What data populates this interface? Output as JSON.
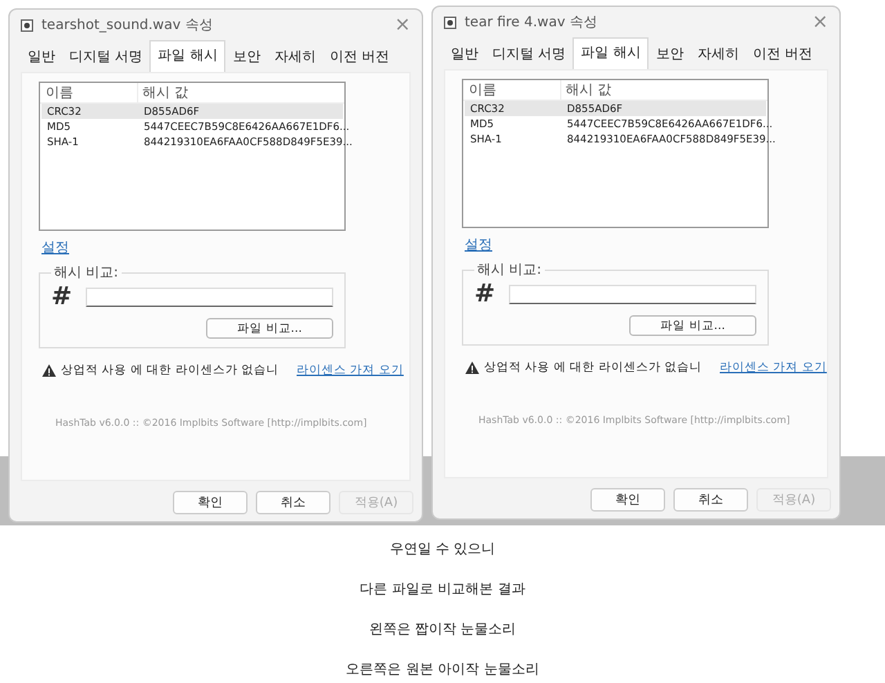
{
  "windows": [
    {
      "title": "tearshot_sound.wav 속성",
      "close": "×",
      "tabs": [
        {
          "label": "일반",
          "selected": false
        },
        {
          "label": "디지털 서명",
          "selected": false
        },
        {
          "label": "파일 해시",
          "selected": true
        },
        {
          "label": "보안",
          "selected": false
        },
        {
          "label": "자세히",
          "selected": false
        },
        {
          "label": "이전 버전",
          "selected": false
        }
      ],
      "hash_list": {
        "columns": [
          "이름",
          "해시 값"
        ],
        "rows": [
          {
            "name": "CRC32",
            "value": "D855AD6F",
            "selected": true
          },
          {
            "name": "MD5",
            "value": "5447CEEC7B59C8E6426AA667E1DF6...",
            "selected": false
          },
          {
            "name": "SHA-1",
            "value": "844219310EA6FAA0CF588D849F5E39...",
            "selected": false
          }
        ]
      },
      "settings_link": "설정",
      "compare_group": {
        "label": "해시 비교:",
        "icon_glyph": "#",
        "button": "파일 비교..."
      },
      "warning": {
        "text": "상업적 사용 에 대한 라이센스가 없습니",
        "link": "라이센스 가져 오기"
      },
      "footer": "HashTab v6.0.0 :: ©2016 Implbits Software [http://implbits.com]",
      "buttons": [
        {
          "label": "확인",
          "disabled": false
        },
        {
          "label": "취소",
          "disabled": false
        },
        {
          "label": "적용(A)",
          "disabled": true
        }
      ]
    },
    {
      "title": "tear fire 4.wav 속성",
      "close": "×",
      "tabs": [
        {
          "label": "일반",
          "selected": false
        },
        {
          "label": "디지털 서명",
          "selected": false
        },
        {
          "label": "파일 해시",
          "selected": true
        },
        {
          "label": "보안",
          "selected": false
        },
        {
          "label": "자세히",
          "selected": false
        },
        {
          "label": "이전 버전",
          "selected": false
        }
      ],
      "hash_list": {
        "columns": [
          "이름",
          "해시 값"
        ],
        "rows": [
          {
            "name": "CRC32",
            "value": "D855AD6F",
            "selected": true
          },
          {
            "name": "MD5",
            "value": "5447CEEC7B59C8E6426AA667E1DF6...",
            "selected": false
          },
          {
            "name": "SHA-1",
            "value": "844219310EA6FAA0CF588D849F5E39...",
            "selected": false
          }
        ]
      },
      "settings_link": "설정",
      "compare_group": {
        "label": "해시 비교:",
        "icon_glyph": "#",
        "button": "파일 비교..."
      },
      "warning": {
        "text": "상업적 사용 에 대한 라이센스가 없습니",
        "link": "라이센스 가져 오기"
      },
      "footer": "HashTab v6.0.0 :: ©2016 Implbits Software [http://implbits.com]",
      "buttons": [
        {
          "label": "확인",
          "disabled": false
        },
        {
          "label": "취소",
          "disabled": false
        },
        {
          "label": "적용(A)",
          "disabled": true
        }
      ]
    }
  ],
  "captions": [
    "우연일 수 있으니",
    "다른 파일로 비교해본 결과",
    "왼쪽은 짭이작 눈물소리",
    "오른쪽은 원본 아이작 눈물소리"
  ]
}
